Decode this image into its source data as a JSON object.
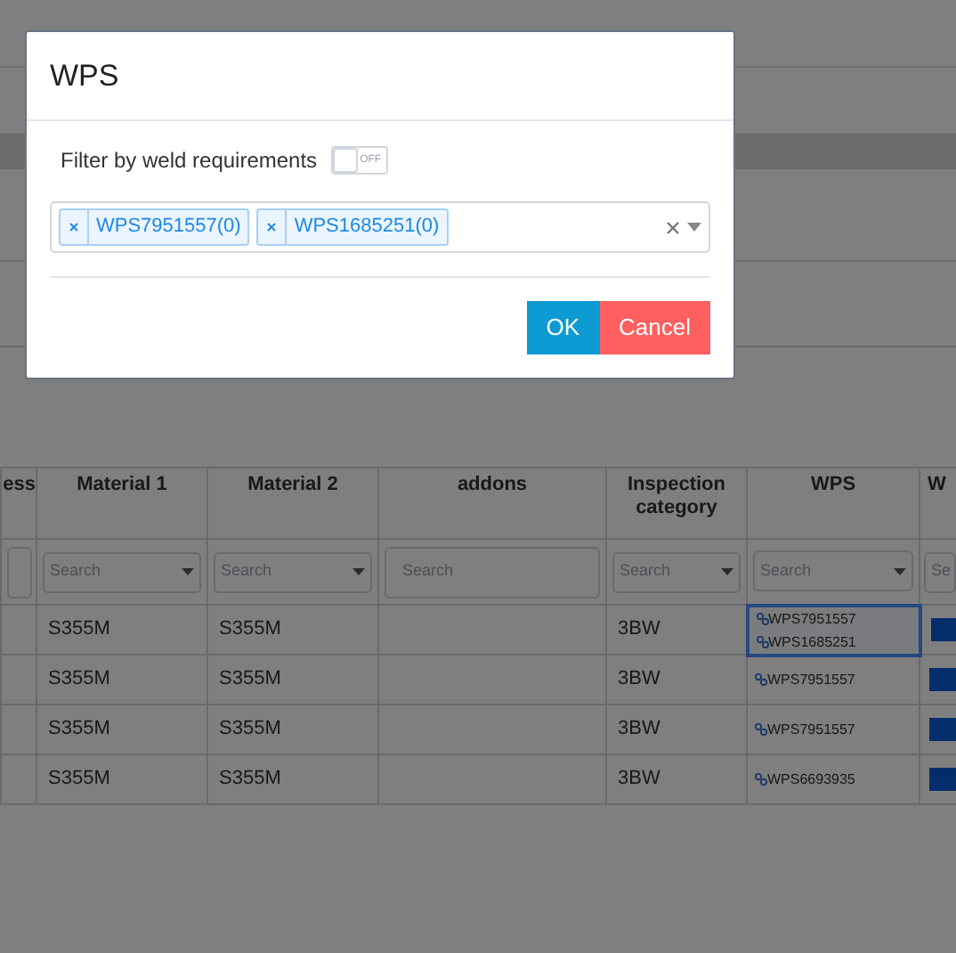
{
  "modal": {
    "title": "WPS",
    "filter_toggle": {
      "label": "Filter by weld requirements",
      "on": false,
      "state_text": "OFF"
    },
    "selected_tags": [
      {
        "label": "WPS7951557(0)"
      },
      {
        "label": "WPS1685251(0)"
      }
    ],
    "buttons": [
      {
        "label": "OK",
        "kind": "primary"
      },
      {
        "label": "Cancel",
        "kind": "danger"
      }
    ]
  },
  "table": {
    "columns": [
      "ess",
      "Material 1",
      "Material 2",
      "addons",
      "Inspection category",
      "WPS",
      "W"
    ],
    "filters": [
      {
        "kind": "text"
      },
      {
        "kind": "dropdown",
        "placeholder": "Search"
      },
      {
        "kind": "dropdown",
        "placeholder": "Search"
      },
      {
        "kind": "text",
        "placeholder": "Search"
      },
      {
        "kind": "dropdown",
        "placeholder": "Search"
      },
      {
        "kind": "dropdown",
        "placeholder": "Search"
      },
      {
        "kind": "dropdown",
        "placeholder": "Se"
      }
    ],
    "rows": [
      {
        "material_1": "S355M",
        "material_2": "S355M",
        "inspection_category": "3BW",
        "wps": [
          "WPS7951557",
          "WPS1685251"
        ],
        "focused": true
      },
      {
        "material_1": "S355M",
        "material_2": "S355M",
        "inspection_category": "3BW",
        "wps": [
          "WPS7951557"
        ],
        "focused": false
      },
      {
        "material_1": "S355M",
        "material_2": "S355M",
        "inspection_category": "3BW",
        "wps": [
          "WPS7951557"
        ],
        "focused": false
      },
      {
        "material_1": "S355M",
        "material_2": "S355M",
        "inspection_category": "3BW",
        "wps": [
          "WPS6693935"
        ],
        "focused": false
      }
    ]
  }
}
